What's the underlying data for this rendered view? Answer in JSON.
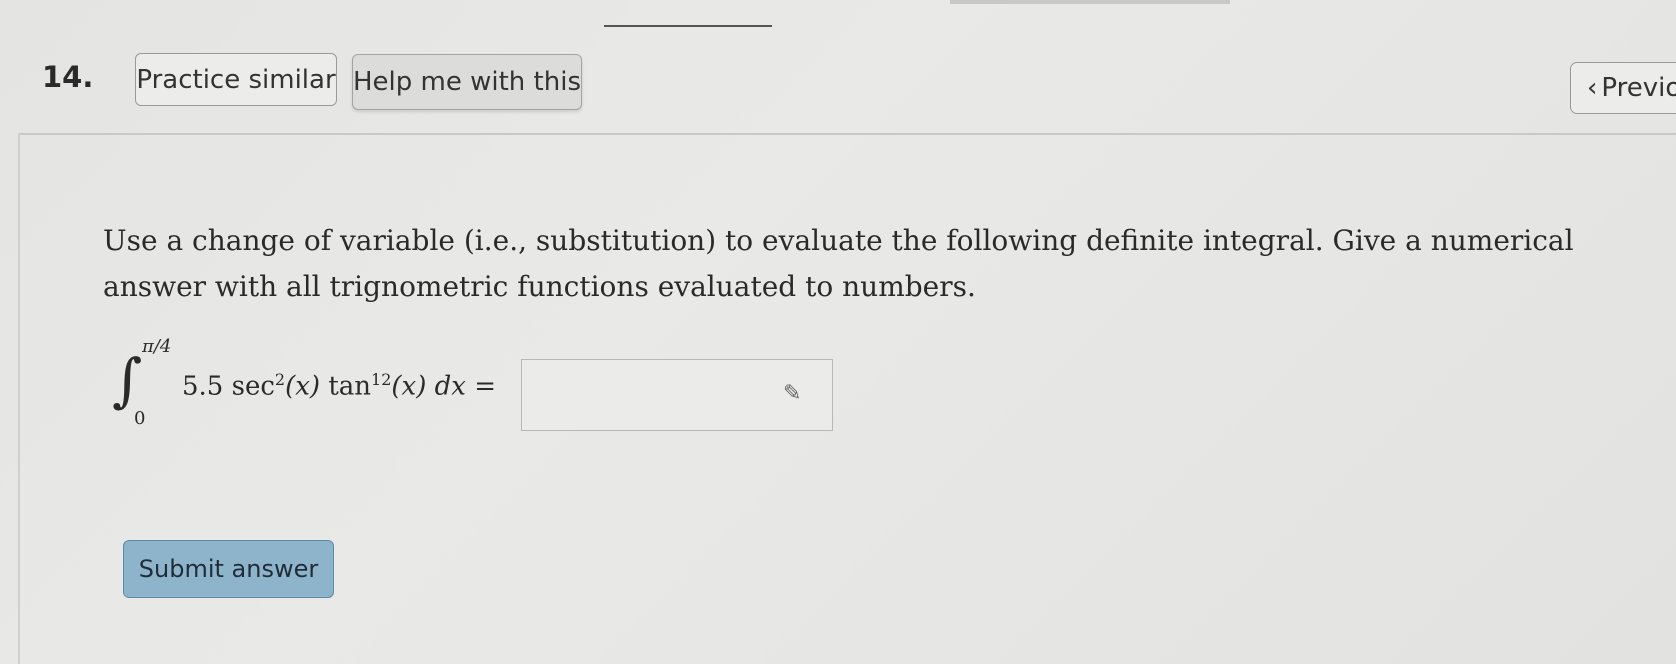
{
  "question": {
    "number": "14.",
    "practice_label": "Practice similar",
    "help_label": "Help me with this",
    "prev_label": "Previo",
    "text": "Use a change of variable (i.e., substitution) to evaluate the following definite integral. Give a numerical answer with all trignometric functions evaluated to numbers."
  },
  "math": {
    "upper_limit": "π/4",
    "lower_limit": "0",
    "coef": "5.5",
    "sec": "sec",
    "sec_exp": "2",
    "tan": "tan",
    "tan_exp": "12",
    "var": "(x)",
    "dx": "dx",
    "equals": "="
  },
  "answer": {
    "value": ""
  },
  "submit_label": "Submit answer",
  "icons": {
    "prev": "chevron-left-icon",
    "answer": "pencil-icon"
  }
}
